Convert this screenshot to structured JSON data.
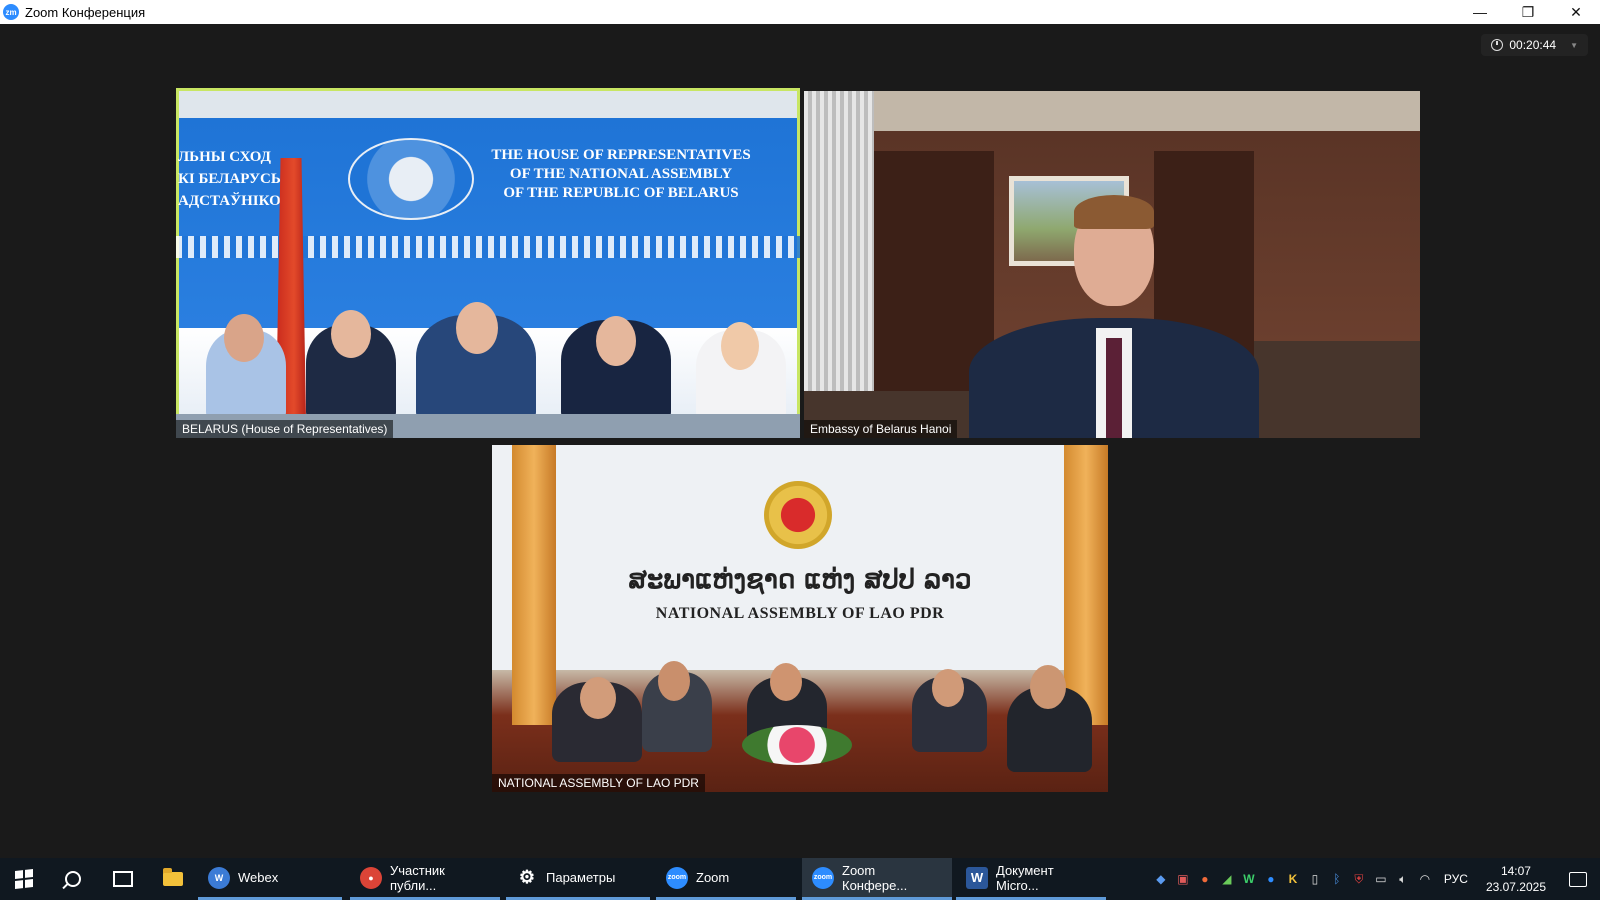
{
  "window": {
    "title": "Zoom Конференция",
    "app_icon_text": "zm",
    "controls": {
      "minimize": "—",
      "restore": "❐",
      "close": "✕"
    }
  },
  "meeting": {
    "timer": "00:20:44",
    "active_speaker_color": "#c8e663",
    "tiles": [
      {
        "name": "BELARUS (House of Representatives)",
        "banner_text": [
          "THE HOUSE OF REPRESENTATIVES",
          "OF THE NATIONAL ASSEMBLY",
          "OF THE REPUBLIC OF BELARUS"
        ],
        "banner_left_text": [
          "ЛЬНЫ СХОД",
          "КІ БЕЛАРУСЬ",
          "АДСТАЎНІКОЎ"
        ]
      },
      {
        "name": "Embassy of Belarus Hanoi"
      },
      {
        "name": "NATIONAL ASSEMBLY OF LAO PDR",
        "banner_script": "ສະພາແຫ່ງຊາດ ແຫ່ງ ສປປ ລາວ",
        "banner_title": "NATIONAL ASSEMBLY OF LAO PDR"
      }
    ]
  },
  "taskbar": {
    "apps": [
      {
        "label": "Webex",
        "icon": "webex-icon",
        "color": "#3b7bd6",
        "glyph": "W"
      },
      {
        "label": "Участник публи...",
        "icon": "chrome-icon",
        "color": "#db4437",
        "glyph": "●"
      },
      {
        "label": "Параметры",
        "icon": "gear-icon",
        "color": "#101820",
        "glyph": "⚙"
      },
      {
        "label": "Zoom",
        "icon": "zoom-icon",
        "color": "#2d8cff",
        "glyph": "zoom"
      },
      {
        "label": "Zoom Конфере...",
        "icon": "zoom-icon",
        "color": "#2d8cff",
        "glyph": "zoom"
      },
      {
        "label": "Документ Micro...",
        "icon": "word-icon",
        "color": "#2b579a",
        "glyph": "W"
      }
    ],
    "tray": {
      "language": "РУС",
      "time": "14:07",
      "date": "23.07.2025"
    }
  }
}
